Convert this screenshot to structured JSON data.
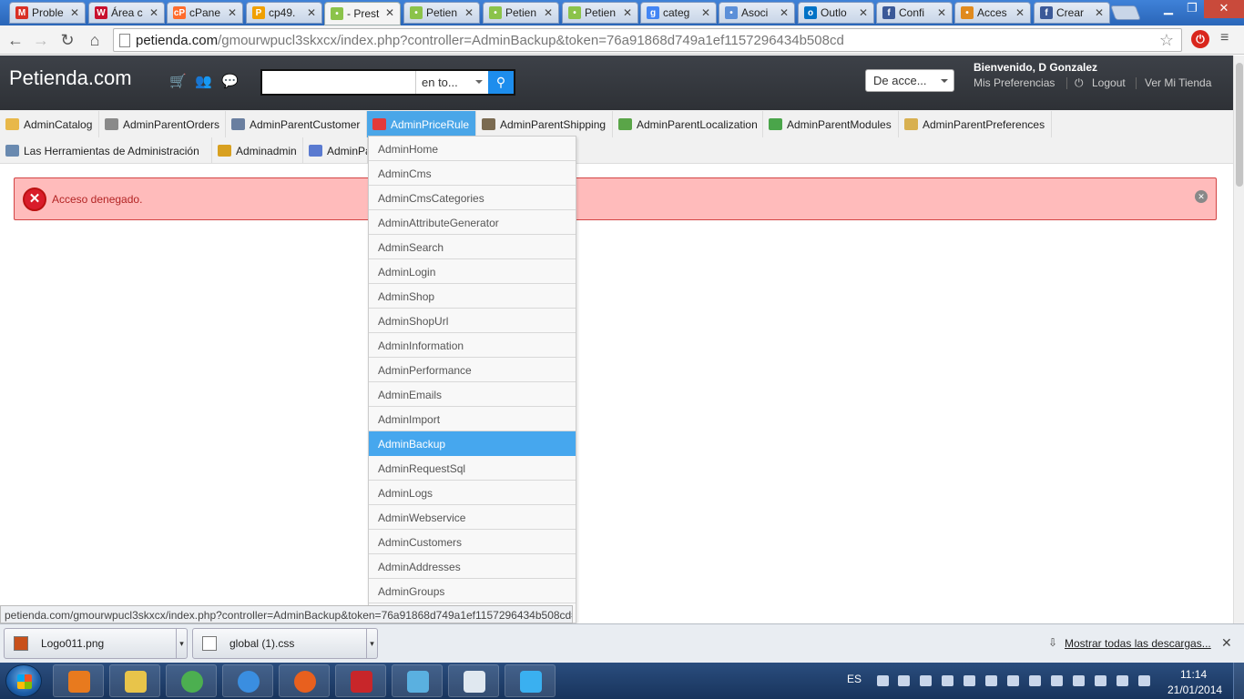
{
  "browser": {
    "tabs": [
      {
        "label": "Proble",
        "fav_color": "#d93025",
        "fav_glyph": "M"
      },
      {
        "label": "Área c",
        "fav_color": "#c8102e",
        "fav_glyph": "W"
      },
      {
        "label": "cPane",
        "fav_color": "#ff6c2c",
        "fav_glyph": "cP"
      },
      {
        "label": "cp49.",
        "fav_color": "#f0a000",
        "fav_glyph": "P"
      },
      {
        "label": "- Prest",
        "fav_color": "#8bc34a",
        "fav_glyph": "•"
      },
      {
        "label": "Petien",
        "fav_color": "#8bc34a",
        "fav_glyph": "•"
      },
      {
        "label": "Petien",
        "fav_color": "#8bc34a",
        "fav_glyph": "•"
      },
      {
        "label": "Petien",
        "fav_color": "#8bc34a",
        "fav_glyph": "•"
      },
      {
        "label": "categ",
        "fav_color": "#4285f4",
        "fav_glyph": "g"
      },
      {
        "label": "Asoci",
        "fav_color": "#5b8fd8",
        "fav_glyph": "•"
      },
      {
        "label": "Outlo",
        "fav_color": "#0072c6",
        "fav_glyph": "o"
      },
      {
        "label": "Confi",
        "fav_color": "#3b5998",
        "fav_glyph": "f"
      },
      {
        "label": "Acces",
        "fav_color": "#e08a1e",
        "fav_glyph": "•"
      },
      {
        "label": "Crear",
        "fav_color": "#3b5998",
        "fav_glyph": "f"
      }
    ],
    "close_glyph": "✕",
    "address": {
      "host": "petienda.com",
      "path": "/gmourwpucl3skxcx/index.php?controller=AdminBackup&token=76a91868d749a1ef1157296434b508cd"
    },
    "status_url": "petienda.com/gmourwpucl3skxcx/index.php?controller=AdminBackup&token=76a91868d749a1ef1157296434b508cd#"
  },
  "header": {
    "brand": "Petienda.com",
    "search_placeholder": "",
    "search_scope": "en to...",
    "quick_access": "De acce...",
    "welcome": "Bienvenido, D Gonzalez",
    "preferences_link": "Mis Preferencias",
    "logout_link": "Logout",
    "view_store_link": "Ver Mi Tienda"
  },
  "menu": {
    "row1": [
      {
        "label": "AdminCatalog",
        "icon_color": "#e8b84a"
      },
      {
        "label": "AdminParentOrders",
        "icon_color": "#8a8a8a"
      },
      {
        "label": "AdminParentCustomer",
        "icon_color": "#6a7fa0"
      },
      {
        "label": "AdminPriceRule",
        "icon_color": "#e23a3a"
      },
      {
        "label": "AdminParentShipping",
        "icon_color": "#7a6a50"
      },
      {
        "label": "AdminParentLocalization",
        "icon_color": "#5aa548"
      },
      {
        "label": "AdminParentModules",
        "icon_color": "#4aa54a"
      },
      {
        "label": "AdminParentPreferences",
        "icon_color": "#d8b050"
      }
    ],
    "row2": [
      {
        "label": "Las Herramientas de Administración",
        "icon_color": "#6a8ab0"
      },
      {
        "label": "Adminadmin",
        "icon_color": "#d8a020"
      },
      {
        "label": "AdminPa",
        "icon_color": "#5a7ad0"
      }
    ]
  },
  "submenu": {
    "items": [
      "AdminHome",
      "AdminCms",
      "AdminCmsCategories",
      "AdminAttributeGenerator",
      "AdminSearch",
      "AdminLogin",
      "AdminShop",
      "AdminShopUrl",
      "AdminInformation",
      "AdminPerformance",
      "AdminEmails",
      "AdminImport",
      "AdminBackup",
      "AdminRequestSql",
      "AdminLogs",
      "AdminWebservice",
      "AdminCustomers",
      "AdminAddresses",
      "AdminGroups"
    ],
    "active": "AdminBackup"
  },
  "alert": {
    "message": "Acceso denegado."
  },
  "downloads": {
    "items": [
      "Logo011.png",
      "global (1).css"
    ],
    "show_all": "Mostrar todas las descargas..."
  },
  "taskbar": {
    "language": "ES",
    "time": "11:14",
    "date": "21/01/2014",
    "apps": [
      {
        "name": "media-player",
        "color": "#e87a1e"
      },
      {
        "name": "file-explorer",
        "color": "#e8c44a"
      },
      {
        "name": "chrome",
        "color": "#4caf50"
      },
      {
        "name": "internet-explorer",
        "color": "#3a8ee0"
      },
      {
        "name": "firefox",
        "color": "#e8601e"
      },
      {
        "name": "pdf-reader",
        "color": "#c8262a"
      },
      {
        "name": "image-viewer",
        "color": "#5ab0e0"
      },
      {
        "name": "text-editor",
        "color": "#e0e8f0"
      },
      {
        "name": "star-app",
        "color": "#3ab0f0"
      }
    ]
  },
  "colors": {
    "accent": "#46a7ee",
    "alert_bg": "#ffbbbb",
    "alert_text": "#b32424",
    "header_bg": "#383838"
  }
}
